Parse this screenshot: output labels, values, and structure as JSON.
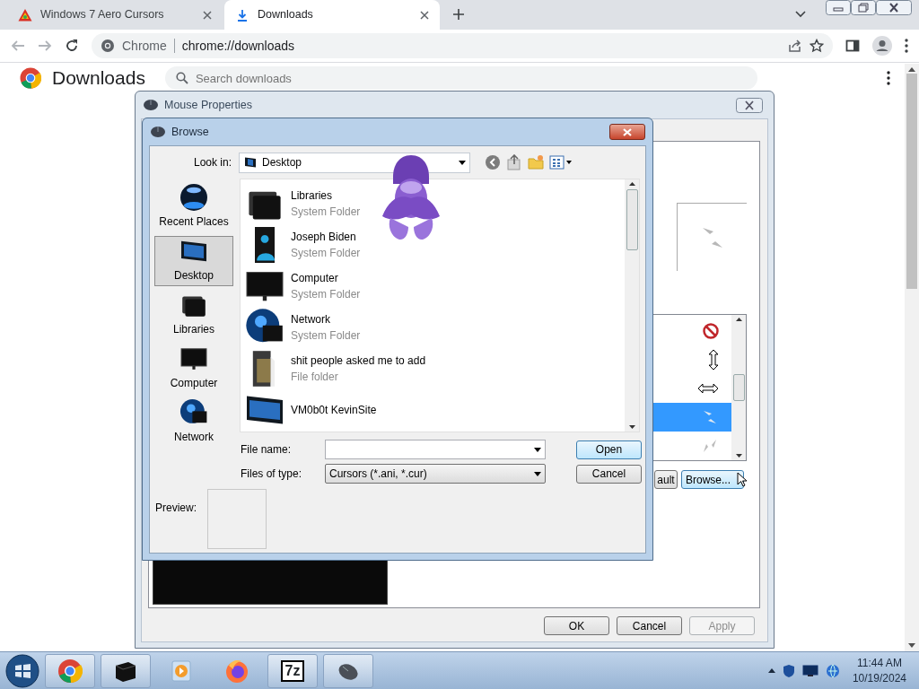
{
  "browser": {
    "tabs": [
      {
        "title": "Windows 7 Aero Cursors",
        "kind": "site",
        "selected": false
      },
      {
        "title": "Downloads",
        "kind": "downloads",
        "selected": true
      }
    ],
    "address": {
      "chip": "Chrome",
      "url": "chrome://downloads"
    }
  },
  "downloads_page": {
    "title": "Downloads",
    "search": {
      "placeholder": "Search downloads"
    }
  },
  "mouse_properties": {
    "title": "Mouse Properties",
    "pointers": [
      {
        "kind": "unavailable",
        "selected": false
      },
      {
        "kind": "vertical-resize",
        "selected": false
      },
      {
        "kind": "horizontal-resize",
        "selected": false
      },
      {
        "kind": "diagonal-resize",
        "selected": true
      },
      {
        "kind": "diagonal-resize-alt",
        "selected": false
      }
    ],
    "use_default_label": "ault",
    "browse_label": "Browse...",
    "footer_buttons": [
      {
        "label": "OK",
        "disabled": false
      },
      {
        "label": "Cancel",
        "disabled": false
      },
      {
        "label": "Apply",
        "disabled": true
      }
    ]
  },
  "browse_dialog": {
    "title": "Browse",
    "look_in": {
      "label": "Look in:",
      "value": "Desktop"
    },
    "places": [
      {
        "label": "Recent Places",
        "kind": "recent",
        "selected": false
      },
      {
        "label": "Desktop",
        "kind": "desktop",
        "selected": true
      },
      {
        "label": "Libraries",
        "kind": "libraries",
        "selected": false
      },
      {
        "label": "Computer",
        "kind": "computer",
        "selected": false
      },
      {
        "label": "Network",
        "kind": "network",
        "selected": false
      }
    ],
    "files": [
      {
        "name": "Libraries",
        "type": "System Folder",
        "kind": "libraries"
      },
      {
        "name": "Joseph Biden",
        "type": "System Folder",
        "kind": "user"
      },
      {
        "name": "Computer",
        "type": "System Folder",
        "kind": "computer"
      },
      {
        "name": "Network",
        "type": "System Folder",
        "kind": "network"
      },
      {
        "name": "shit people asked me to add",
        "type": "File folder",
        "kind": "folder"
      },
      {
        "name": "VM0b0t KevinSite",
        "kind": "desktop"
      }
    ],
    "file_name": {
      "label": "File name:"
    },
    "file_type": {
      "label": "Files of type:",
      "value": "Cursors (*.ani, *.cur)"
    },
    "buttons": [
      {
        "label": "Open",
        "default": true
      },
      {
        "label": "Cancel",
        "default": false
      }
    ],
    "preview_label": "Preview:"
  },
  "taskbar": {
    "apps": [
      {
        "kind": "chrome",
        "running": true
      },
      {
        "kind": "explorer",
        "running": true
      },
      {
        "kind": "media",
        "running": false
      },
      {
        "kind": "firefox",
        "running": false
      },
      {
        "kind": "sevenzip",
        "running": true,
        "label": "7z"
      },
      {
        "kind": "mouse",
        "running": true
      }
    ],
    "clock": {
      "time": "11:44 AM",
      "date": "10/19/2024"
    }
  }
}
